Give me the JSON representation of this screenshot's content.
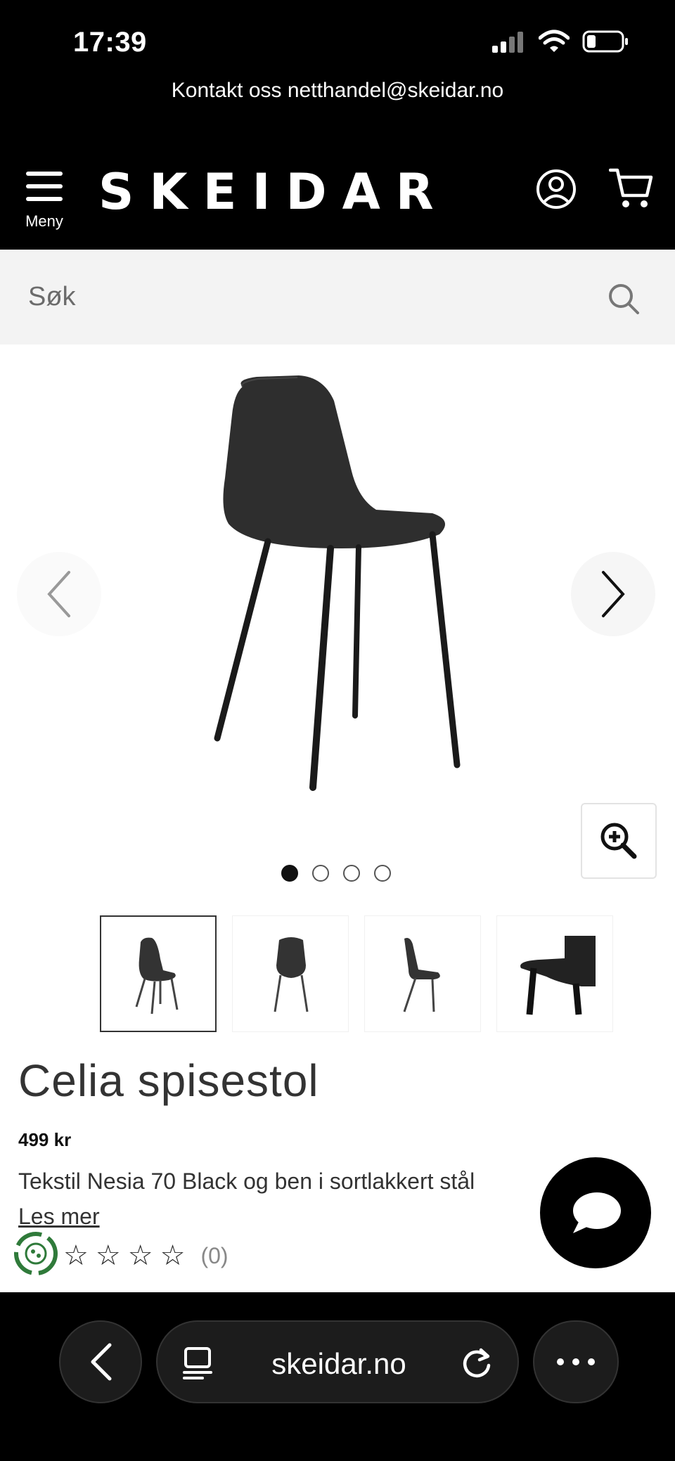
{
  "status_bar": {
    "time": "17:39"
  },
  "topbar": {
    "contact_text": "Kontakt oss netthandel@skeidar.no"
  },
  "header": {
    "menu_label": "Meny",
    "logo_text": "SKEIDAR"
  },
  "search": {
    "placeholder": "Søk"
  },
  "gallery": {
    "image_count": 4,
    "active_index": 0
  },
  "product": {
    "title": "Celia spisestol",
    "price": "499 kr",
    "description": "Tekstil Nesia 70 Black og ben i sortlakkert stål",
    "read_more": "Les mer",
    "rating_count": "(0)"
  },
  "browser": {
    "url": "skeidar.no"
  },
  "colors": {
    "header_bg": "#000000",
    "search_bg": "#f3f3f3",
    "text": "#222222"
  }
}
